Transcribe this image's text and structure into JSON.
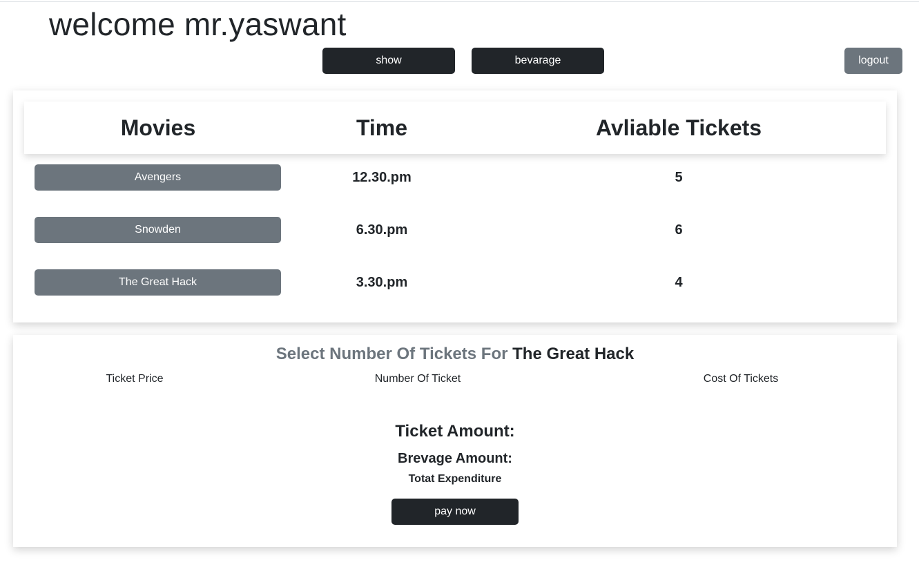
{
  "header": {
    "welcome": "welcome mr.yaswant",
    "show_label": "show",
    "beverage_label": "bevarage",
    "logout_label": "logout"
  },
  "movies_table": {
    "headers": {
      "movies": "Movies",
      "time": "Time",
      "tickets": "Avliable Tickets"
    },
    "rows": [
      {
        "movie": "Avengers",
        "time": "12.30.pm",
        "tickets": "5"
      },
      {
        "movie": "Snowden",
        "time": "6.30.pm",
        "tickets": "6"
      },
      {
        "movie": "The Great Hack",
        "time": "3.30.pm",
        "tickets": "4"
      }
    ]
  },
  "order": {
    "title_prefix": "Select Number Of Tickets For",
    "selected_movie": "The Great Hack",
    "ticket_price_label": "Ticket Price",
    "number_label": "Number Of Ticket",
    "cost_label": "Cost Of Tickets",
    "ticket_amount_label": "Ticket Amount:",
    "brevage_amount_label": "Brevage Amount:",
    "total_label": "Totat Expenditure",
    "pay_label": "pay now"
  },
  "colors": {
    "dark": "#212529",
    "secondary": "#6c757d"
  }
}
